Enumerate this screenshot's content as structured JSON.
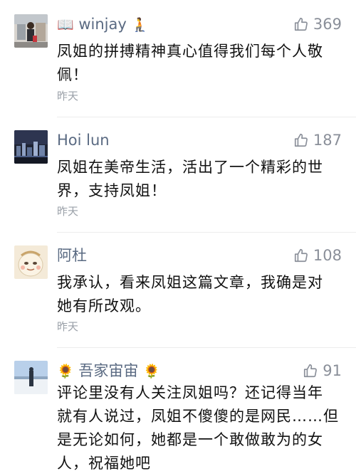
{
  "comments": [
    {
      "name_prefix": "📖",
      "name": "winjay",
      "name_suffix": "🧎",
      "likes": "369",
      "text_lines": [
        "凤姐的拼搏精神真心值得我们每个人敬",
        "佩！"
      ],
      "time": "昨天"
    },
    {
      "name": "Hoi lun",
      "likes": "187",
      "text_lines": [
        "凤姐在美帝生活，活出了一个精彩的世",
        "界，支持凤姐！"
      ],
      "time": "昨天"
    },
    {
      "name": "阿杜",
      "likes": "108",
      "text_lines": [
        "我承认，看来凤姐这篇文章，我确是对",
        "她有所改观。"
      ],
      "time": "昨天"
    },
    {
      "name_prefix": "🌻",
      "name": "吾家宙宙",
      "name_suffix": "🌻",
      "likes": "91",
      "text_lines": [
        "评论里没有人关注凤姐吗？还记得当年",
        "就有人说过，凤姐不傻傻的是网民……但",
        "是无论如何，她都是一个敢做敢为的女",
        "人，祝福她吧"
      ]
    }
  ],
  "colors": {
    "name": "#5a6a82",
    "likes": "#8a8f99",
    "text": "#111111",
    "time": "#9aa0a8"
  }
}
